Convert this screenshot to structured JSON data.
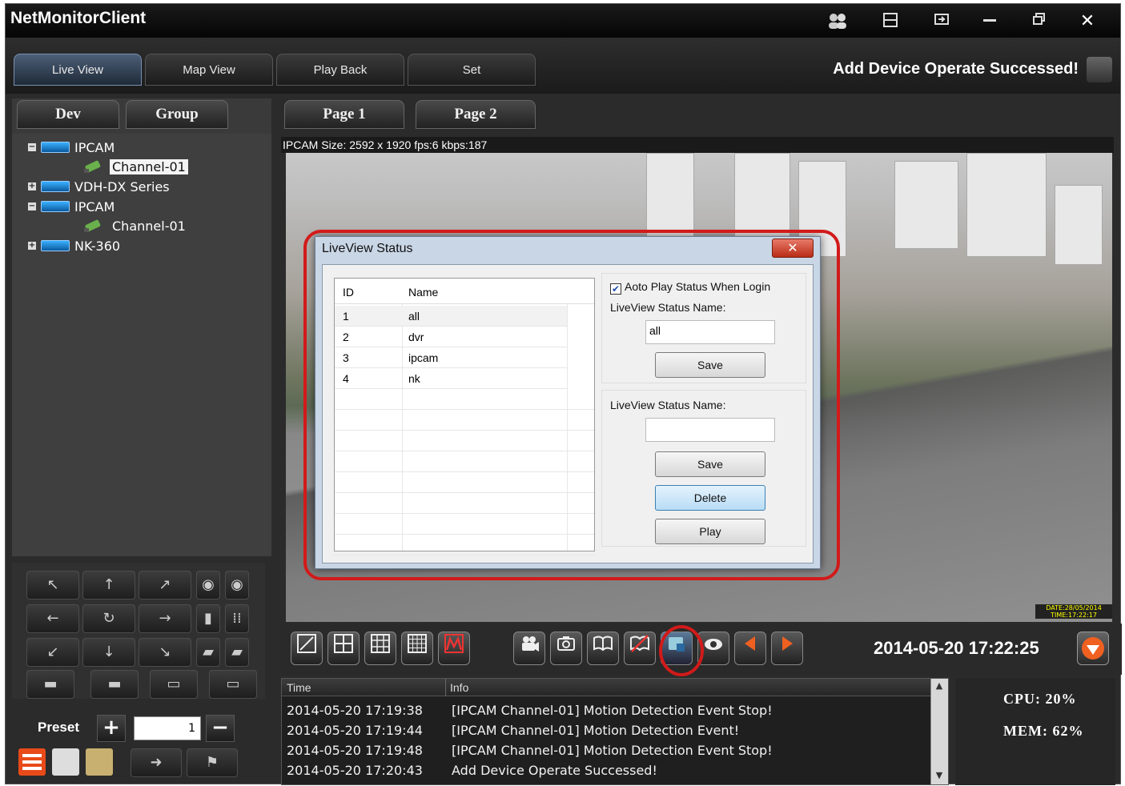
{
  "window": {
    "title": "NetMonitorClient",
    "status_message": "Add Device Operate Successed!"
  },
  "nav_tabs": [
    {
      "label": "Live View",
      "active": true
    },
    {
      "label": "Map View",
      "active": false
    },
    {
      "label": "Play Back",
      "active": false
    },
    {
      "label": "Set",
      "active": false
    }
  ],
  "left_tabs": {
    "dev": "Dev",
    "group": "Group"
  },
  "device_tree": [
    {
      "label": "IPCAM",
      "expander": "−"
    },
    {
      "label": "Channel-01",
      "selected": true
    },
    {
      "label": "VDH-DX Series",
      "expander": "+"
    },
    {
      "label": "IPCAM",
      "expander": "−"
    },
    {
      "label": "Channel-01",
      "selected": false
    },
    {
      "label": "NK-360",
      "expander": "+"
    }
  ],
  "ptz": {
    "arrows": [
      "↖",
      "↑",
      "↗",
      "←",
      "↻",
      "→",
      "↙",
      "↓",
      "↘"
    ]
  },
  "preset": {
    "label": "Preset",
    "plus": "+",
    "minus": "−",
    "value": "1"
  },
  "pages": [
    "Page 1",
    "Page 2"
  ],
  "video": {
    "info": "IPCAM Size: 2592 x 1920 fps:6 kbps:187",
    "stamp": "DATE:28/05/2014 TIME:17:22:17"
  },
  "dialog": {
    "title": "LiveView Status",
    "close": "✕",
    "columns": [
      "ID",
      "Name"
    ],
    "rows": [
      {
        "id": "1",
        "name": "all"
      },
      {
        "id": "2",
        "name": "dvr"
      },
      {
        "id": "3",
        "name": "ipcam"
      },
      {
        "id": "4",
        "name": "nk"
      }
    ],
    "auto_play_label": "Aoto Play Status When Login",
    "auto_play_checked": true,
    "name_label_1": "LiveView Status Name:",
    "name_value_1": "all",
    "save_1": "Save",
    "name_label_2": "LiveView Status Name:",
    "name_value_2": "",
    "save_2": "Save",
    "delete": "Delete",
    "play": "Play"
  },
  "toolbar": {
    "datetime": "2014-05-20 17:22:25"
  },
  "log": {
    "columns": [
      "Time",
      "Info"
    ],
    "rows": [
      {
        "time": "2014-05-20 17:19:38",
        "info": "[IPCAM Channel-01] Motion Detection Event Stop!"
      },
      {
        "time": "2014-05-20 17:19:44",
        "info": "[IPCAM Channel-01] Motion Detection Event!"
      },
      {
        "time": "2014-05-20 17:19:48",
        "info": "[IPCAM Channel-01] Motion Detection Event Stop!"
      },
      {
        "time": "2014-05-20 17:20:43",
        "info": "Add Device Operate Successed!"
      }
    ]
  },
  "stats": {
    "cpu": "CPU:  20%",
    "mem": "MEM:  62%"
  }
}
